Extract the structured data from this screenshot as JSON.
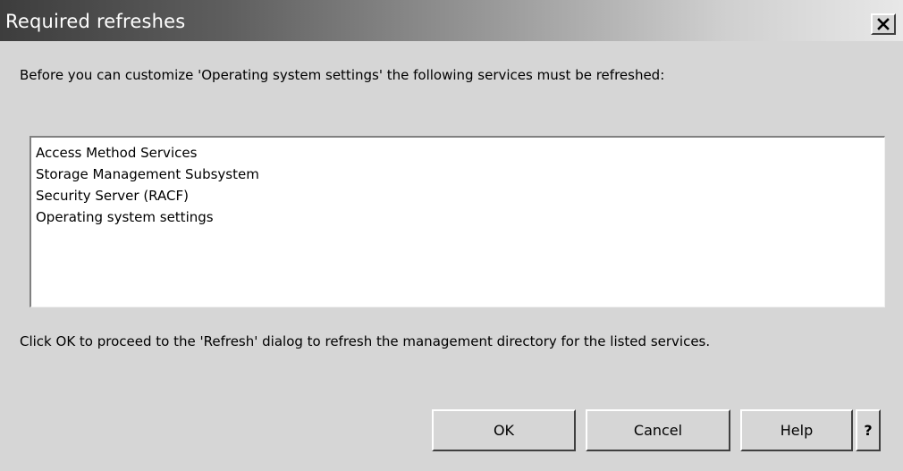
{
  "dialog": {
    "title": "Required refreshes",
    "close_icon": "close-icon",
    "intro_text": "Before you can customize 'Operating system settings' the following services must be refreshed:",
    "services": [
      "Access Method Services",
      "Storage Management Subsystem",
      "Security Server (RACF)",
      "Operating system settings"
    ],
    "outro_text": "Click OK to proceed to the 'Refresh' dialog to refresh the management directory for the listed services.",
    "buttons": {
      "ok": "OK",
      "cancel": "Cancel",
      "help": "Help",
      "context_help": "?"
    }
  },
  "colors": {
    "dialog_background": "#d6d6d6",
    "titlebar_dark": "#3d3d3d",
    "titlebar_light": "#e8e8e8",
    "list_background": "#ffffff"
  }
}
